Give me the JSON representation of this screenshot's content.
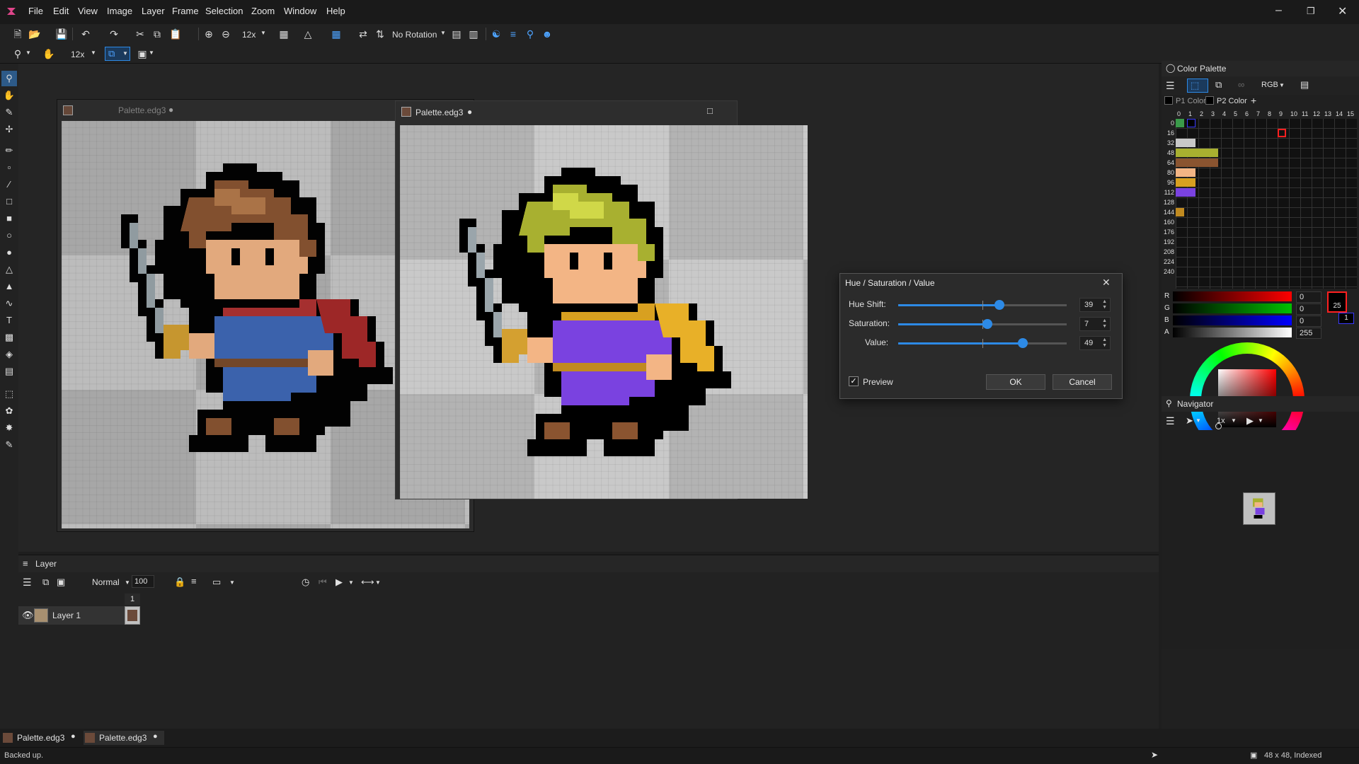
{
  "app": {
    "menu": [
      "File",
      "Edit",
      "View",
      "Image",
      "Layer",
      "Frame",
      "Selection",
      "Zoom",
      "Window",
      "Help"
    ]
  },
  "toolbar": {
    "zoom1": "12x",
    "rotation": "No Rotation",
    "zoom2": "12x"
  },
  "documents": [
    {
      "title": "Palette.edg3",
      "modified_marker": "●"
    },
    {
      "title": "Palette.edg3",
      "modified_marker": "●"
    }
  ],
  "dialog": {
    "title": "Hue / Saturation / Value",
    "hue": {
      "label": "Hue Shift:",
      "value": "39",
      "fraction": 0.6
    },
    "saturation": {
      "label": "Saturation:",
      "value": "7",
      "fraction": 0.53
    },
    "value": {
      "label": "Value:",
      "value": "49",
      "fraction": 0.74
    },
    "preview_label": "Preview",
    "preview_checked": true,
    "ok_label": "OK",
    "cancel_label": "Cancel"
  },
  "color_palette": {
    "title": "Color Palette",
    "mode": "RGB",
    "tab1": "P1 Color",
    "tab2": "P2 Color",
    "add": "+",
    "columns": [
      "0",
      "1",
      "2",
      "3",
      "4",
      "5",
      "6",
      "7",
      "8",
      "9",
      "10",
      "11",
      "12",
      "13",
      "14",
      "15"
    ],
    "rows": [
      "0",
      "16",
      "32",
      "48",
      "64",
      "80",
      "96",
      "112",
      "128",
      "144",
      "160",
      "176",
      "192",
      "208",
      "224",
      "240"
    ],
    "channels": [
      {
        "label": "R",
        "value": "0",
        "color": "#ff0000"
      },
      {
        "label": "G",
        "value": "0",
        "color": "#00c000"
      },
      {
        "label": "B",
        "value": "0",
        "color": "#0000ff"
      },
      {
        "label": "A",
        "value": "255",
        "color": "#ffffff"
      }
    ],
    "index_primary": "25",
    "index_secondary": "1"
  },
  "navigator": {
    "title": "Navigator",
    "zoom": "1x"
  },
  "layer_panel": {
    "title": "Layer",
    "blend_mode": "Normal",
    "opacity": "100",
    "frame_number": "1",
    "layers": [
      {
        "name": "Layer 1",
        "visible": true
      }
    ]
  },
  "bottom_tabs": [
    {
      "label": "Palette.edg3",
      "marker": "●"
    },
    {
      "label": "Palette.edg3",
      "marker": "●"
    }
  ],
  "status": {
    "left": "Backed up.",
    "right": "48 x 48, Indexed"
  }
}
